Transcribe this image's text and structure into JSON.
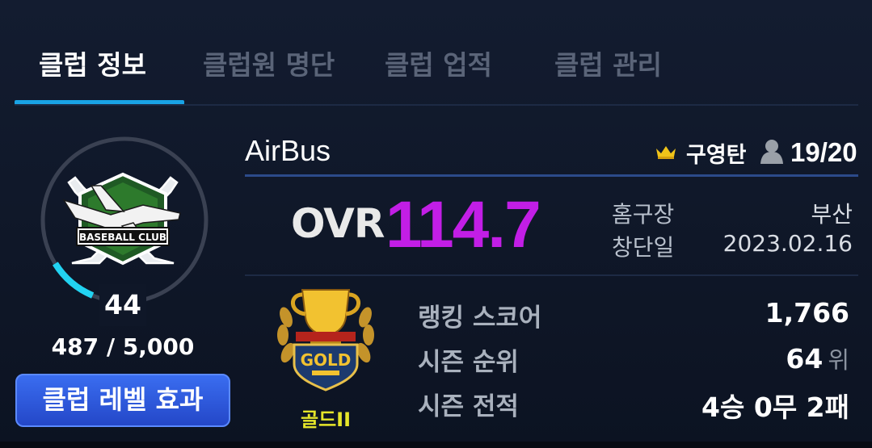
{
  "tabs": [
    {
      "label": "클럽 정보",
      "active": true
    },
    {
      "label": "클럽원 명단",
      "active": false
    },
    {
      "label": "클럽 업적",
      "active": false
    },
    {
      "label": "클럽 관리",
      "active": false
    }
  ],
  "club": {
    "name": "AirBus",
    "emblem_text": "BASEBALL CLUB",
    "leader": "구영탄",
    "members": "19/20",
    "level": "44",
    "xp": "487 / 5,000",
    "xp_progress": 0.0974,
    "level_button": "클럽 레벨 효과"
  },
  "ovr": {
    "label": "OVR",
    "value": "114.7"
  },
  "info": [
    {
      "label": "홈구장",
      "value": "부산"
    },
    {
      "label": "창단일",
      "value": "2023.02.16"
    }
  ],
  "league": {
    "badge_text": "GOLD",
    "tier": "골드II"
  },
  "stats": [
    {
      "label": "랭킹 스코어",
      "value": "1,766",
      "unit": ""
    },
    {
      "label": "시즌 순위",
      "value": "64",
      "unit": "위"
    },
    {
      "label": "시즌 전적",
      "value": "4승 0무 2패",
      "unit": ""
    }
  ],
  "colors": {
    "accent_blue": "#19a3e6",
    "ovr_purple": "#c21ee6",
    "tier_yellow": "#e6e62a",
    "button_blue": "#2f5ae0",
    "progress_cyan": "#22d3f2"
  }
}
